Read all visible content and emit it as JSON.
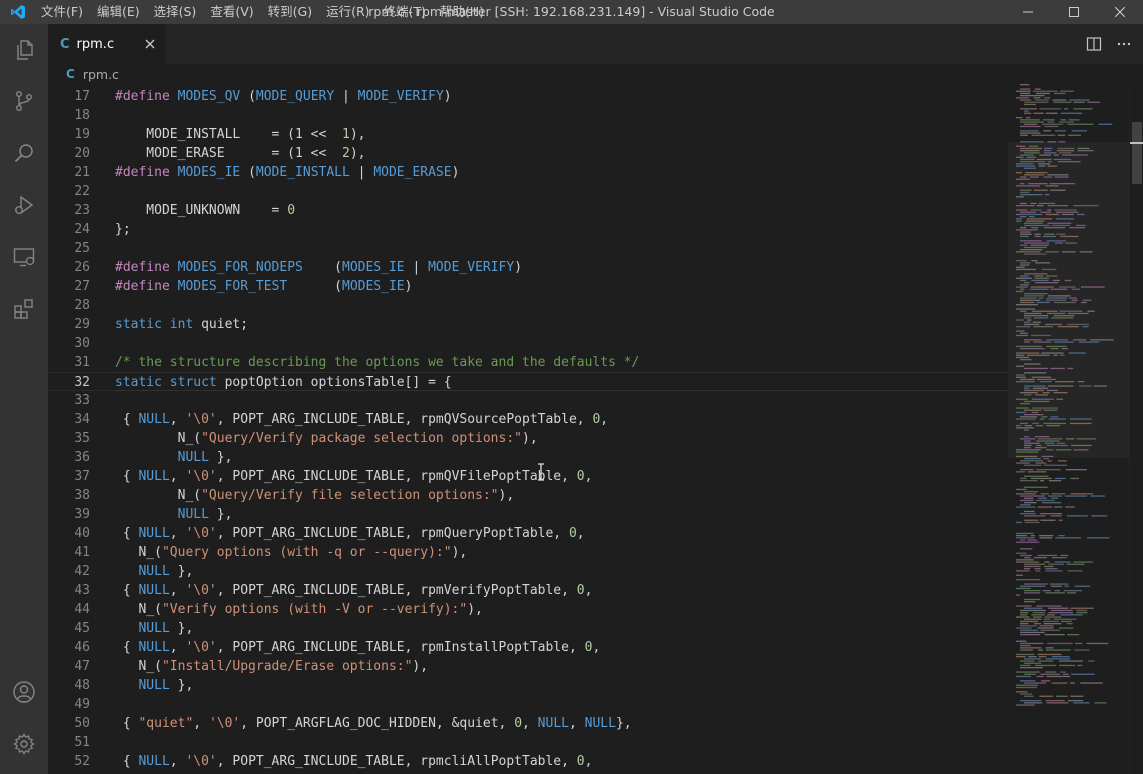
{
  "window": {
    "title": "rpm.c - rpm-master [SSH: 192.168.231.149] - Visual Studio Code",
    "menu": [
      "文件(F)",
      "编辑(E)",
      "选择(S)",
      "查看(V)",
      "转到(G)",
      "运行(R)",
      "终端(T)",
      "帮助(H)"
    ]
  },
  "activity_bar": {
    "items": [
      "explorer-icon",
      "source-control-icon",
      "search-icon",
      "run-debug-icon",
      "remote-explorer-icon",
      "extensions-icon"
    ],
    "bottom": [
      "accounts-icon",
      "settings-gear-icon"
    ]
  },
  "tabs": [
    {
      "label": "rpm.c",
      "icon": "C",
      "active": true
    }
  ],
  "breadcrumb": {
    "icon": "C",
    "file": "rpm.c"
  },
  "editor": {
    "current_line": 32,
    "lines": [
      {
        "n": 17,
        "tokens": [
          [
            "kw-pre",
            "#define "
          ],
          [
            "mac",
            "MODES_QV"
          ],
          [
            "plain",
            " ("
          ],
          [
            "mac",
            "MODE_QUERY"
          ],
          [
            "plain",
            " | "
          ],
          [
            "mac",
            "MODE_VERIFY"
          ],
          [
            "plain",
            ")"
          ]
        ]
      },
      {
        "n": 18,
        "tokens": []
      },
      {
        "n": 19,
        "tokens": [
          [
            "plain",
            "    MODE_INSTALL    = (1 << "
          ],
          [
            "num-lit",
            " 1"
          ],
          [
            "plain",
            "),"
          ]
        ]
      },
      {
        "n": 20,
        "tokens": [
          [
            "plain",
            "    MODE_ERASE      = (1 << "
          ],
          [
            "num-lit",
            " 2"
          ],
          [
            "plain",
            "),"
          ]
        ]
      },
      {
        "n": 21,
        "tokens": [
          [
            "kw-pre",
            "#define "
          ],
          [
            "mac",
            "MODES_IE"
          ],
          [
            "plain",
            " ("
          ],
          [
            "mac",
            "MODE_INSTALL"
          ],
          [
            "plain",
            " | "
          ],
          [
            "mac",
            "MODE_ERASE"
          ],
          [
            "plain",
            ")"
          ]
        ]
      },
      {
        "n": 22,
        "tokens": []
      },
      {
        "n": 23,
        "tokens": [
          [
            "plain",
            "    MODE_UNKNOWN    = "
          ],
          [
            "num-lit",
            "0"
          ]
        ]
      },
      {
        "n": 24,
        "tokens": [
          [
            "plain",
            "};"
          ]
        ]
      },
      {
        "n": 25,
        "tokens": []
      },
      {
        "n": 26,
        "tokens": [
          [
            "kw-pre",
            "#define "
          ],
          [
            "mac",
            "MODES_FOR_NODEPS"
          ],
          [
            "plain",
            "    ("
          ],
          [
            "mac",
            "MODES_IE"
          ],
          [
            "plain",
            " | "
          ],
          [
            "mac",
            "MODE_VERIFY"
          ],
          [
            "plain",
            ")"
          ]
        ]
      },
      {
        "n": 27,
        "tokens": [
          [
            "kw-pre",
            "#define "
          ],
          [
            "mac",
            "MODES_FOR_TEST"
          ],
          [
            "plain",
            "      ("
          ],
          [
            "mac",
            "MODES_IE"
          ],
          [
            "plain",
            ")"
          ]
        ]
      },
      {
        "n": 28,
        "tokens": []
      },
      {
        "n": 29,
        "tokens": [
          [
            "kw",
            "static int "
          ],
          [
            "plain",
            "quiet;"
          ]
        ]
      },
      {
        "n": 30,
        "tokens": []
      },
      {
        "n": 31,
        "tokens": [
          [
            "cmt",
            "/* the structure describing the options we take and the defaults */"
          ]
        ]
      },
      {
        "n": 32,
        "tokens": [
          [
            "kw",
            "static struct "
          ],
          [
            "plain",
            "poptOption optionsTable[] = {"
          ]
        ]
      },
      {
        "n": 33,
        "tokens": []
      },
      {
        "n": 34,
        "tokens": [
          [
            "plain",
            " { "
          ],
          [
            "kw",
            "NULL"
          ],
          [
            "plain",
            ", "
          ],
          [
            "str",
            "'\\0'"
          ],
          [
            "plain",
            ", POPT_ARG_INCLUDE_TABLE, rpmQVSourcePoptTable, "
          ],
          [
            "num-lit",
            "0"
          ],
          [
            "plain",
            ","
          ]
        ]
      },
      {
        "n": 35,
        "tokens": [
          [
            "plain",
            "        N_("
          ],
          [
            "str",
            "\"Query/Verify package selection options:\""
          ],
          [
            "plain",
            "),"
          ]
        ]
      },
      {
        "n": 36,
        "tokens": [
          [
            "plain",
            "        "
          ],
          [
            "kw",
            "NULL"
          ],
          [
            "plain",
            " },"
          ]
        ]
      },
      {
        "n": 37,
        "tokens": [
          [
            "plain",
            " { "
          ],
          [
            "kw",
            "NULL"
          ],
          [
            "plain",
            ", "
          ],
          [
            "str",
            "'\\0'"
          ],
          [
            "plain",
            ", POPT_ARG_INCLUDE_TABLE, rpmQVFilePoptTable, "
          ],
          [
            "num-lit",
            "0"
          ],
          [
            "plain",
            ","
          ]
        ]
      },
      {
        "n": 38,
        "tokens": [
          [
            "plain",
            "        N_("
          ],
          [
            "str",
            "\"Query/Verify file selection options:\""
          ],
          [
            "plain",
            "),"
          ]
        ]
      },
      {
        "n": 39,
        "tokens": [
          [
            "plain",
            "        "
          ],
          [
            "kw",
            "NULL"
          ],
          [
            "plain",
            " },"
          ]
        ]
      },
      {
        "n": 40,
        "tokens": [
          [
            "plain",
            " { "
          ],
          [
            "kw",
            "NULL"
          ],
          [
            "plain",
            ", "
          ],
          [
            "str",
            "'\\0'"
          ],
          [
            "plain",
            ", POPT_ARG_INCLUDE_TABLE, rpmQueryPoptTable, "
          ],
          [
            "num-lit",
            "0"
          ],
          [
            "plain",
            ","
          ]
        ]
      },
      {
        "n": 41,
        "tokens": [
          [
            "plain",
            "   N_("
          ],
          [
            "str",
            "\"Query options (with -q or --query):\""
          ],
          [
            "plain",
            "),"
          ]
        ]
      },
      {
        "n": 42,
        "tokens": [
          [
            "plain",
            "   "
          ],
          [
            "kw",
            "NULL"
          ],
          [
            "plain",
            " },"
          ]
        ]
      },
      {
        "n": 43,
        "tokens": [
          [
            "plain",
            " { "
          ],
          [
            "kw",
            "NULL"
          ],
          [
            "plain",
            ", "
          ],
          [
            "str",
            "'\\0'"
          ],
          [
            "plain",
            ", POPT_ARG_INCLUDE_TABLE, rpmVerifyPoptTable, "
          ],
          [
            "num-lit",
            "0"
          ],
          [
            "plain",
            ","
          ]
        ]
      },
      {
        "n": 44,
        "tokens": [
          [
            "plain",
            "   N_("
          ],
          [
            "str",
            "\"Verify options (with -V or --verify):\""
          ],
          [
            "plain",
            "),"
          ]
        ]
      },
      {
        "n": 45,
        "tokens": [
          [
            "plain",
            "   "
          ],
          [
            "kw",
            "NULL"
          ],
          [
            "plain",
            " },"
          ]
        ]
      },
      {
        "n": 46,
        "tokens": [
          [
            "plain",
            " { "
          ],
          [
            "kw",
            "NULL"
          ],
          [
            "plain",
            ", "
          ],
          [
            "str",
            "'\\0'"
          ],
          [
            "plain",
            ", POPT_ARG_INCLUDE_TABLE, rpmInstallPoptTable, "
          ],
          [
            "num-lit",
            "0"
          ],
          [
            "plain",
            ","
          ]
        ]
      },
      {
        "n": 47,
        "tokens": [
          [
            "plain",
            "   N_("
          ],
          [
            "str",
            "\"Install/Upgrade/Erase options:\""
          ],
          [
            "plain",
            "),"
          ]
        ]
      },
      {
        "n": 48,
        "tokens": [
          [
            "plain",
            "   "
          ],
          [
            "kw",
            "NULL"
          ],
          [
            "plain",
            " },"
          ]
        ]
      },
      {
        "n": 49,
        "tokens": []
      },
      {
        "n": 50,
        "tokens": [
          [
            "plain",
            " { "
          ],
          [
            "str",
            "\"quiet\""
          ],
          [
            "plain",
            ", "
          ],
          [
            "str",
            "'\\0'"
          ],
          [
            "plain",
            ", POPT_ARGFLAG_DOC_HIDDEN, &quiet, "
          ],
          [
            "num-lit",
            "0"
          ],
          [
            "plain",
            ", "
          ],
          [
            "kw",
            "NULL"
          ],
          [
            "plain",
            ", "
          ],
          [
            "kw",
            "NULL"
          ],
          [
            "plain",
            "},"
          ]
        ]
      },
      {
        "n": 51,
        "tokens": []
      },
      {
        "n": 52,
        "tokens": [
          [
            "plain",
            " { "
          ],
          [
            "kw",
            "NULL"
          ],
          [
            "plain",
            ", "
          ],
          [
            "str",
            "'\\0'"
          ],
          [
            "plain",
            ", POPT_ARG_INCLUDE_TABLE, rpmcliAllPoptTable, "
          ],
          [
            "num-lit",
            "0"
          ],
          [
            "plain",
            ","
          ]
        ]
      }
    ]
  },
  "colors": {
    "accent": "#007acc",
    "titlebar": "#3c3c3c",
    "activitybar": "#333333",
    "editor_bg": "#1e1e1e"
  }
}
